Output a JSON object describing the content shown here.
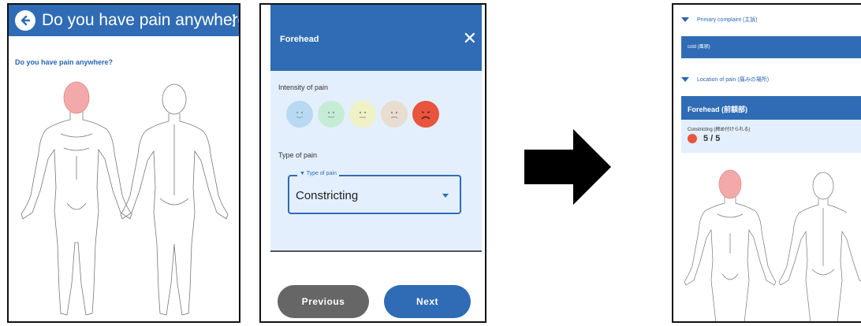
{
  "screen1": {
    "title": "Do you have pain anywhere?",
    "question": "Do you have pain anywhere?",
    "icons": [
      "back-arrow-icon",
      "more-vert-icon"
    ],
    "selected_region": "head"
  },
  "screen2": {
    "dialog_title": "Forehead",
    "intensity_label": "Intensity of pain",
    "pain_faces": [
      {
        "level": 1,
        "color": "#b9d8f2",
        "icon": "face-smile-icon"
      },
      {
        "level": 2,
        "color": "#c6ecd6",
        "icon": "face-smile-icon"
      },
      {
        "level": 3,
        "color": "#f0f1c4",
        "icon": "face-neutral-icon"
      },
      {
        "level": 4,
        "color": "#e8ddd0",
        "icon": "face-frown-icon"
      },
      {
        "level": 5,
        "color": "#e8543d",
        "icon": "face-sad-icon"
      }
    ],
    "selected_level": 5,
    "type_label": "Type of pain",
    "select_legend": "▼ Type of pain",
    "select_value": "Constricting",
    "previous_label": "Previous",
    "next_label": "Next"
  },
  "screen3": {
    "primary_complaint_label": "Primary complaint (主訴)",
    "primary_complaint_value": "cold (風邪)",
    "location_label": "Location of pain (痛みの場所)",
    "location_name": "Forehead (前額部)",
    "pain_type": "Constricting (締め付けられる)",
    "pain_score": "5 / 5"
  },
  "colors": {
    "primary": "#2f6cb5",
    "light_bg": "#e3effd",
    "highlight": "#f0a8a8",
    "pain_max": "#e8543d"
  }
}
